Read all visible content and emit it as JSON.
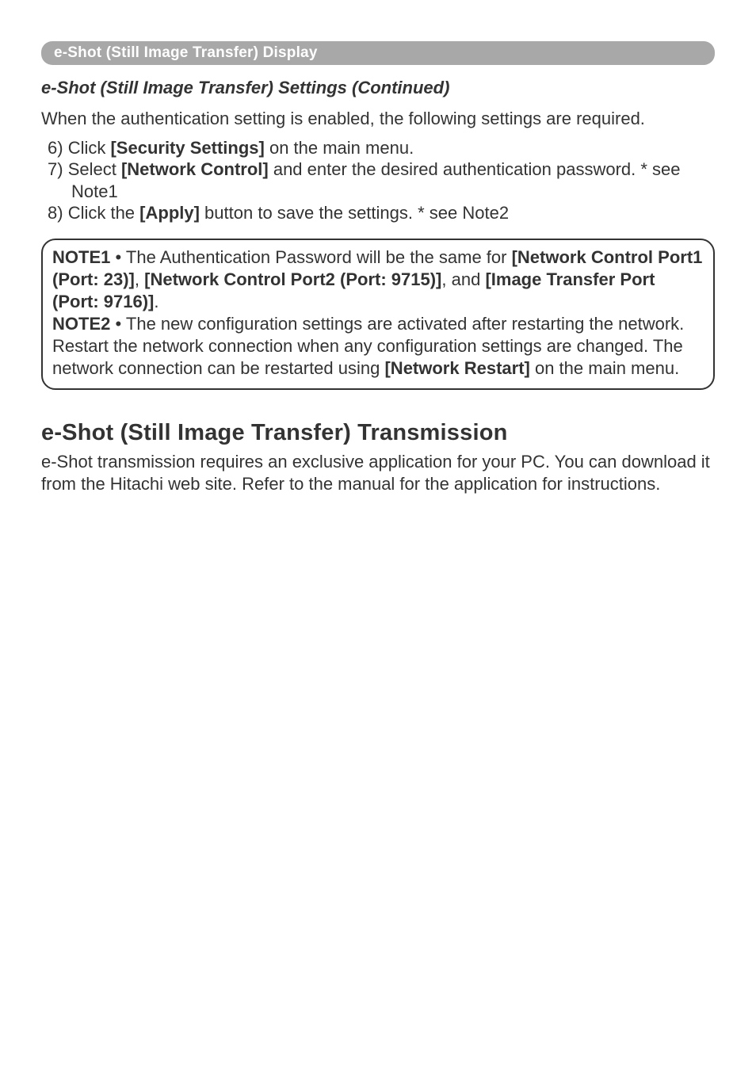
{
  "banner": {
    "title": "e-Shot (Still Image Transfer) Display"
  },
  "subtitle": "e-Shot (Still Image Transfer) Settings (Continued)",
  "intro": "When the authentication setting is enabled, the following settings are required.",
  "steps": {
    "s6_num": "6) ",
    "s6_a": "Click ",
    "s6_b": "[Security Settings]",
    "s6_c": " on the main menu.",
    "s7_num": "7) ",
    "s7_a": "Select ",
    "s7_b": "[Network Control]",
    "s7_c": " and enter the desired authentication password. * see Note1",
    "s8_num": "8) ",
    "s8_a": "Click the ",
    "s8_b": "[Apply]",
    "s8_c": " button to save the settings. * see Note2"
  },
  "notes": {
    "n1_label": "NOTE1",
    "n1_a": "  • The Authentication Password will be the same for ",
    "n1_b": "[Network Control Port1 (Port: 23)]",
    "n1_c": ", ",
    "n1_d": "[Network Control Port2 (Port: 9715)]",
    "n1_e": ", and ",
    "n1_f": "[Image Transfer Port (Port: 9716)]",
    "n1_g": ".",
    "n2_label": "NOTE2",
    "n2_a": "  • The new configuration settings are activated after restarting the network. Restart the network connection when any configuration settings are changed. The network connection can be restarted using ",
    "n2_b": "[Network Restart]",
    "n2_c": " on the main menu."
  },
  "section": {
    "heading": "e-Shot (Still Image Transfer) Transmission",
    "body": "e-Shot transmission requires an exclusive application for your PC. You can download it from the Hitachi web site. Refer to the manual for the application for instructions."
  }
}
